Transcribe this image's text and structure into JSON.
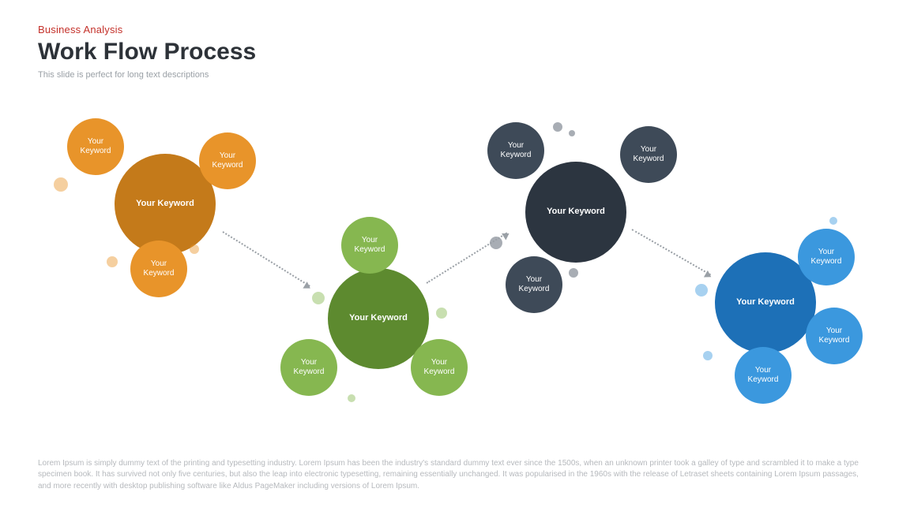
{
  "header": {
    "category": "Business Analysis",
    "title": "Work Flow Process",
    "subtitle": "This slide is perfect for long text descriptions"
  },
  "clusters": [
    {
      "id": "orange",
      "mainColor": "#c47a1a",
      "satColor": "#e8942a",
      "dotColor": "rgba(232,148,42,0.45)",
      "mainLabel": "Your Keyword",
      "satLabel": "Your\nKeyword"
    },
    {
      "id": "green",
      "mainColor": "#5d8a2f",
      "satColor": "#86b750",
      "dotColor": "rgba(134,183,80,0.45)",
      "mainLabel": "Your Keyword",
      "satLabel": "Your\nKeyword"
    },
    {
      "id": "navy",
      "mainColor": "#2c3540",
      "satColor": "#3e4a58",
      "dotColor": "rgba(62,74,88,0.45)",
      "mainLabel": "Your Keyword",
      "satLabel": "Your\nKeyword"
    },
    {
      "id": "blue",
      "mainColor": "#1d70b7",
      "satColor": "#3b98de",
      "dotColor": "rgba(59,152,222,0.45)",
      "mainLabel": "Your Keyword",
      "satLabel": "Your\nKeyword"
    }
  ],
  "footer": "Lorem Ipsum is simply dummy text of the printing and typesetting industry. Lorem Ipsum has been the industry's standard dummy text ever since the 1500s, when an unknown printer took a galley of type and scrambled it to make a type specimen book. It has survived not only five centuries, but also the leap into electronic typesetting, remaining essentially unchanged. It was popularised in the 1960s with the release of Letraset sheets containing Lorem Ipsum passages, and more recently with desktop publishing software like Aldus PageMaker including versions of Lorem Ipsum."
}
